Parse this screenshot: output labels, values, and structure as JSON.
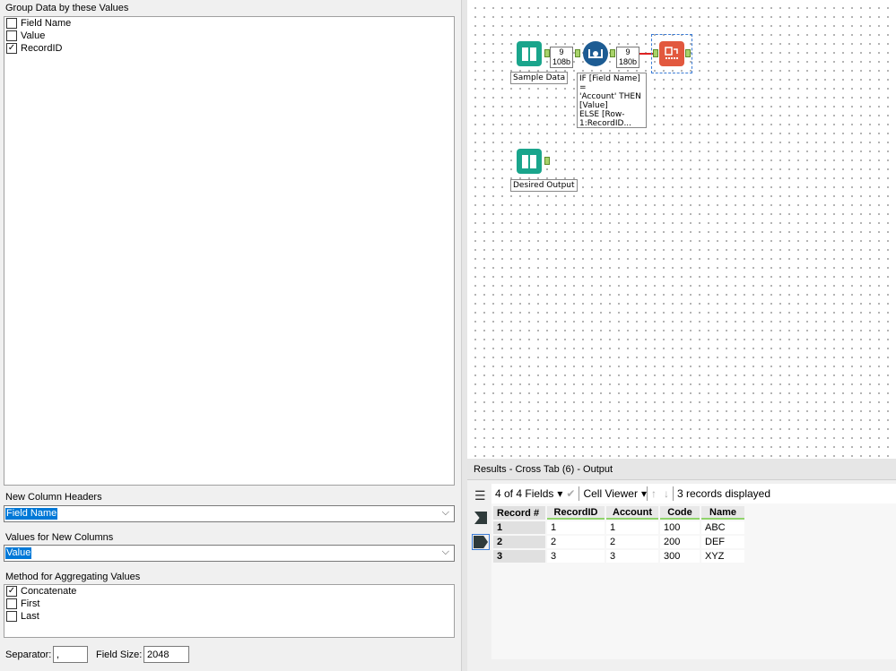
{
  "config": {
    "group_label": "Group Data by these Values",
    "group_fields": [
      {
        "label": "Field Name",
        "checked": false
      },
      {
        "label": "Value",
        "checked": false
      },
      {
        "label": "RecordID",
        "checked": true
      }
    ],
    "headers_label": "New Column Headers",
    "headers_value": "Field Name",
    "values_label": "Values for New Columns",
    "values_value": "Value",
    "method_label": "Method for Aggregating Values",
    "methods": [
      {
        "label": "Concatenate",
        "checked": true
      },
      {
        "label": "First",
        "checked": false
      },
      {
        "label": "Last",
        "checked": false
      }
    ],
    "separator_label": "Separator:",
    "separator_value": ",",
    "field_size_label": "Field Size:",
    "field_size_value": "2048"
  },
  "canvas": {
    "tools": [
      {
        "name": "Sample Data",
        "icon": "text-input-book-icon",
        "color": "#1aa58c"
      },
      {
        "name": "Formula",
        "icon": "multi-row-formula-icon",
        "color": "#1d5c93"
      },
      {
        "name": "Cross Tab",
        "icon": "cross-tab-icon",
        "color": "#e2583e"
      },
      {
        "name": "Desired Output",
        "icon": "text-input-book-icon",
        "color": "#1aa58c"
      }
    ],
    "badge1": {
      "records": "9",
      "size": "108b"
    },
    "badge2": {
      "records": "9",
      "size": "180b"
    },
    "label_sample": "Sample Data",
    "label_formula": [
      "IF [Field Name] =",
      "'Account' THEN",
      "[Value]",
      "ELSE [Row-",
      "1:RecordID..."
    ],
    "label_desired": "Desired Output"
  },
  "results": {
    "title": "Results - Cross Tab (6) - Output",
    "fields": "4 of 4 Fields",
    "viewer": "Cell Viewer",
    "status": "3 records displayed",
    "columns": [
      "Record #",
      "RecordID",
      "Account",
      "Code",
      "Name"
    ],
    "rows": [
      [
        "1",
        "1",
        "1",
        "100",
        "ABC"
      ],
      [
        "2",
        "2",
        "2",
        "200",
        "DEF"
      ],
      [
        "3",
        "3",
        "3",
        "300",
        "XYZ"
      ]
    ]
  }
}
